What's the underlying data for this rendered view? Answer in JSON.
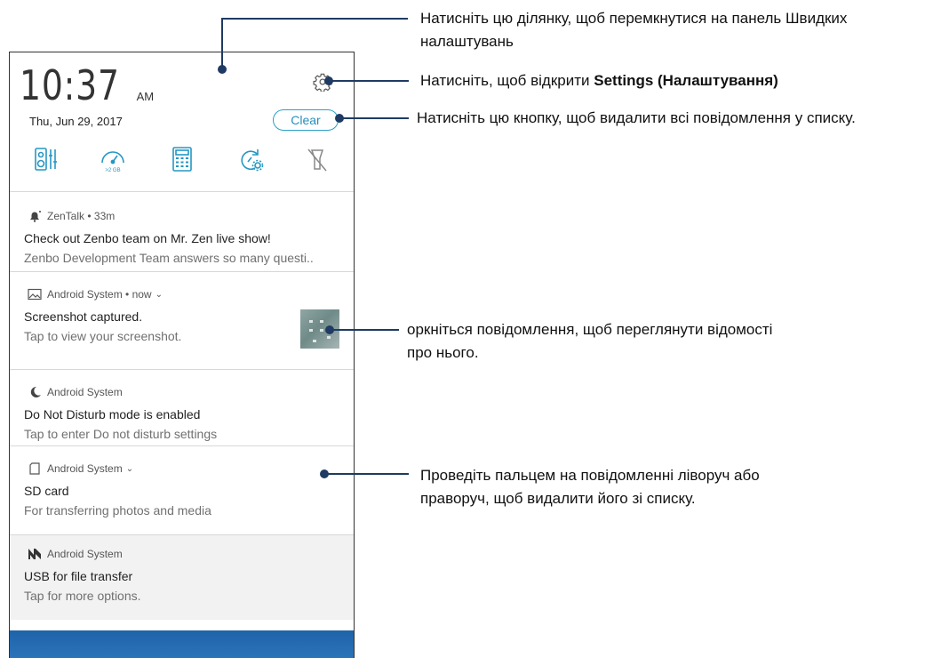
{
  "status": {
    "time": "10:37",
    "ampm": "AM",
    "date": "Thu, Jun 29, 2017",
    "clear_label": "Clear"
  },
  "quick_tiles": [
    {
      "icon": "speaker-settings-icon"
    },
    {
      "icon": "speed-booster-icon",
      "label": ">2 GB"
    },
    {
      "icon": "calculator-icon"
    },
    {
      "icon": "auto-sync-icon"
    },
    {
      "icon": "flashlight-off-icon"
    }
  ],
  "notifications": [
    {
      "app": "ZenTalk",
      "time": "• 33m",
      "title": "Check out Zenbo team on Mr. Zen live show!",
      "body": "Zenbo Development Team answers so many questi.."
    },
    {
      "app": "Android System",
      "time": "• now",
      "title": "Screenshot captured.",
      "body": "Tap to view your screenshot."
    },
    {
      "app": "Android System",
      "time": "",
      "title": "Do Not Disturb mode is enabled",
      "body": "Tap to enter Do not disturb settings"
    },
    {
      "app": "Android System",
      "time": "",
      "title": "SD card",
      "body": "For transferring photos and media"
    },
    {
      "app": "Android System",
      "time": "",
      "title": "USB for file transfer",
      "body": "Tap for more options."
    }
  ],
  "callouts": {
    "quick_settings": "Натисніть цю ділянку, щоб перемкнутися на панель Швидких налаштувань",
    "settings_prefix": "Натисніть, щоб відкрити ",
    "settings_bold": "Settings (Налаштування)",
    "clear": "Натисніть цю кнопку, щоб видалити всі повідомлення у списку.",
    "details": "оркніться повідомлення, щоб переглянути відомості про нього.",
    "swipe": "Проведіть пальцем на повідомленні ліворуч або праворуч, щоб видалити його зі списку."
  },
  "colors": {
    "accent": "#2aa0c8",
    "callout_line": "#1f3b63",
    "wallpaper": "#2a6fb5"
  }
}
